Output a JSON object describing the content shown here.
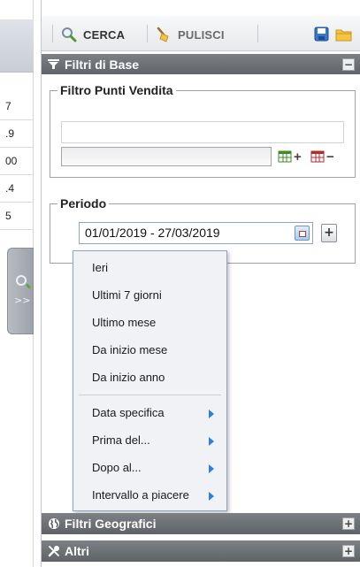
{
  "left_table": {
    "rows": [
      "7",
      ".9",
      "00",
      ".4",
      "5"
    ],
    "expand_handle": {
      "icon": "search-expand-icon",
      "arrows": ">>"
    }
  },
  "toolbar": {
    "search_label": "CERCA",
    "clear_label": "PULISCI",
    "icons": [
      "search-icon",
      "broom-icon",
      "save-icon",
      "folder-icon"
    ]
  },
  "sections": {
    "base": {
      "title": "Filtri di Base",
      "toggle": "−",
      "icon": "filter-icon"
    },
    "geo": {
      "title": "Filtri Geografici",
      "toggle": "+",
      "icon": "globe-icon"
    },
    "other": {
      "title": "Altri",
      "toggle": "+",
      "icon": "tools-icon"
    }
  },
  "stores_filter": {
    "legend": "Filtro Punti Vendita",
    "add_symbol": "+",
    "remove_symbol": "−"
  },
  "period": {
    "legend": "Periodo",
    "date_range": "01/01/2019  -  27/03/2019",
    "add_symbol": "+"
  },
  "period_menu": {
    "quick": [
      "Ieri",
      "Ultimi 7 giorni",
      "Ultimo mese",
      "Da inizio mese",
      "Da inizio anno"
    ],
    "advanced": [
      "Data specifica",
      "Prima del...",
      "Dopo al...",
      "Intervallo a piacere"
    ]
  },
  "colors": {
    "section_header": "#6e7277",
    "menu_bg": "#f0f2f5",
    "submenu_arrow": "#2f7ed8"
  }
}
